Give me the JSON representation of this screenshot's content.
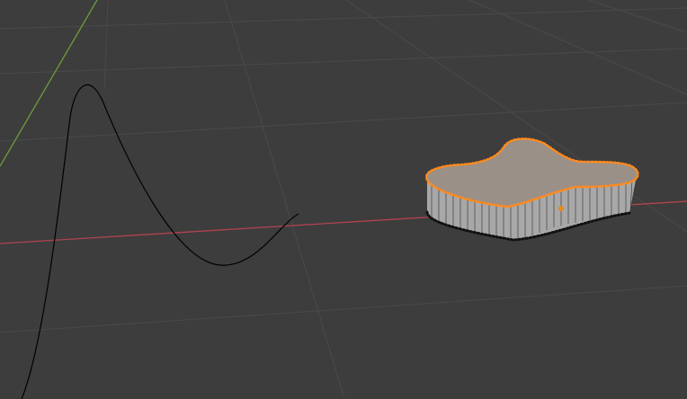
{
  "viewport": {
    "mode": "edit-mode",
    "background_color": "#3d3d3d",
    "grid_color": "#4a4a4a",
    "x_axis_color": "#b0434f",
    "y_axis_color": "#6c9c3b"
  },
  "curve": {
    "type": "bezier-curve",
    "color": "#000000"
  },
  "mesh": {
    "type": "extruded-blob-mesh",
    "selected": true,
    "selection_color": "#ff8a1d",
    "face_color": "#9a9088",
    "side_color": "#a8a8a8",
    "vertex_color": "#111111",
    "origin_color": "#e38a1a"
  }
}
